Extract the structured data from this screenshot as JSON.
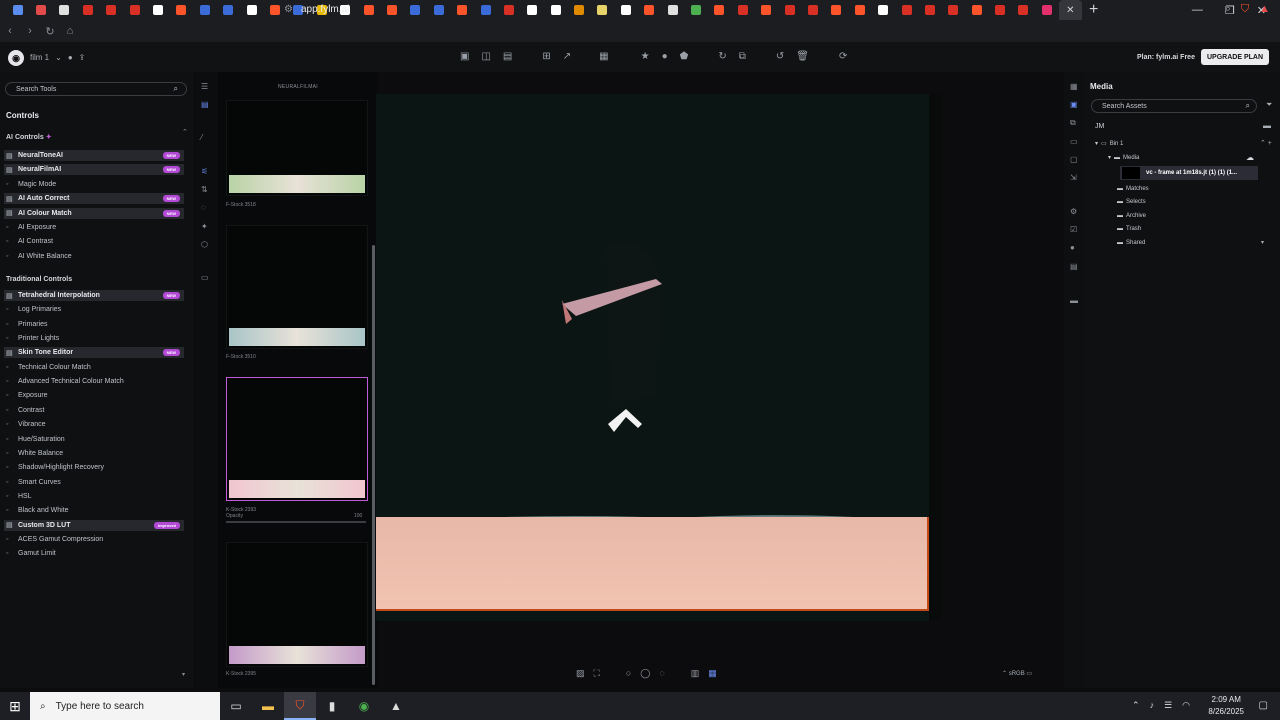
{
  "browser": {
    "url": "app.fylm.ai",
    "tab_colors": [
      "#5b8def",
      "#e34a4a",
      "#e0e0e0",
      "#d93025",
      "#d93025",
      "#d93025",
      "#ffffff",
      "#fb542b",
      "#3a6bd8",
      "#3a6bd8",
      "#ffffff",
      "#fb542b",
      "#3a6bd8",
      "#e6b800",
      "#ffffff",
      "#fb542b",
      "#fb542b",
      "#3a6bd8",
      "#3a6bd8",
      "#fb542b",
      "#3a6bd8",
      "#d93025",
      "#ffffff",
      "#ffffff",
      "#e08a00",
      "#e8d36b",
      "#ffffff",
      "#fb542b",
      "#e0e0e0",
      "#4caf50",
      "#fb542b",
      "#d93025",
      "#fb542b",
      "#d93025",
      "#d93025",
      "#fb542b",
      "#fb542b",
      "#ffffff",
      "#d93025",
      "#d93025",
      "#d93025",
      "#fb542b",
      "#d93025",
      "#d93025",
      "#e1306c"
    ]
  },
  "app": {
    "project": "film 1",
    "plan_label": "Plan: fylm.ai Free",
    "upgrade_label": "UPGRADE PLAN"
  },
  "left_panel": {
    "search_placeholder": "Search Tools",
    "title": "Controls",
    "ai_section": "AI Controls",
    "traditional_section": "Traditional Controls",
    "ai_items": [
      {
        "label": "NeuralToneAI",
        "badge": "NEW",
        "hl": true
      },
      {
        "label": "NeuralFilmAI",
        "badge": "NEW",
        "hl": true
      },
      {
        "label": "Magic Mode",
        "badge": "",
        "hl": false
      },
      {
        "label": "AI Auto Correct",
        "badge": "NEW",
        "hl": true
      },
      {
        "label": "AI Colour Match",
        "badge": "NEW",
        "hl": true
      },
      {
        "label": "AI Exposure",
        "badge": "",
        "hl": false
      },
      {
        "label": "AI Contrast",
        "badge": "",
        "hl": false
      },
      {
        "label": "AI White Balance",
        "badge": "",
        "hl": false
      }
    ],
    "trad_items": [
      {
        "label": "Tetrahedral Interpolation",
        "badge": "NEW",
        "hl": true
      },
      {
        "label": "Log Primaries",
        "badge": "",
        "hl": false
      },
      {
        "label": "Primaries",
        "badge": "",
        "hl": false
      },
      {
        "label": "Printer Lights",
        "badge": "",
        "hl": false
      },
      {
        "label": "Skin Tone Editor",
        "badge": "NEW",
        "hl": true
      },
      {
        "label": "Technical Colour Match",
        "badge": "",
        "hl": false
      },
      {
        "label": "Advanced Technical Colour Match",
        "badge": "",
        "hl": false
      },
      {
        "label": "Exposure",
        "badge": "",
        "hl": false
      },
      {
        "label": "Contrast",
        "badge": "",
        "hl": false
      },
      {
        "label": "Vibrance",
        "badge": "",
        "hl": false
      },
      {
        "label": "Hue/Saturation",
        "badge": "",
        "hl": false
      },
      {
        "label": "White Balance",
        "badge": "",
        "hl": false
      },
      {
        "label": "Shadow/Highlight Recovery",
        "badge": "",
        "hl": false
      },
      {
        "label": "Smart Curves",
        "badge": "",
        "hl": false
      },
      {
        "label": "HSL",
        "badge": "",
        "hl": false
      },
      {
        "label": "Black and White",
        "badge": "",
        "hl": false
      },
      {
        "label": "Custom 3D LUT",
        "badge": "Improved",
        "hl": true
      },
      {
        "label": "ACES Gamut Compression",
        "badge": "",
        "hl": false
      },
      {
        "label": "Gamut Limit",
        "badge": "",
        "hl": false
      }
    ]
  },
  "thumbs": {
    "header": "NEURALFILMAI",
    "items": [
      {
        "label": "F-Stock 3518",
        "strip": "#b9d3a6"
      },
      {
        "label": "F-Stock 3510",
        "strip": "#a9c5c7"
      },
      {
        "label": "K-Stock 2393",
        "strip": "#f1c6cf",
        "selected": true
      },
      {
        "label": "K-Stock 2395",
        "strip": "#c49ac9"
      }
    ],
    "opacity_label": "Opacity",
    "opacity_value": "100"
  },
  "viewer": {
    "colorspace": "sRGB"
  },
  "media_panel": {
    "title": "Media",
    "search_placeholder": "Search Assets",
    "user": "JM",
    "bin": "Bin 1",
    "media_folder": "Media",
    "file": "vc - frame at 1m18s.jt (1) (1) (1...",
    "folders": [
      "Matches",
      "Selects",
      "Archive",
      "Trash",
      "Shared"
    ]
  },
  "taskbar": {
    "search_placeholder": "Type here to search",
    "time": "2:09 AM",
    "date": "8/26/2025"
  }
}
